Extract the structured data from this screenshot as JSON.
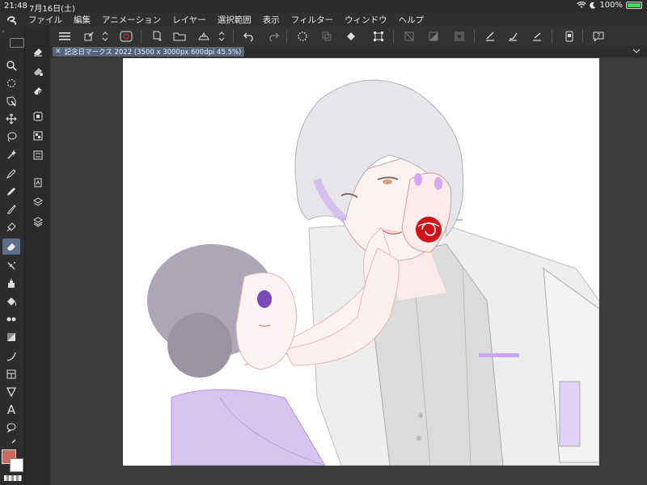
{
  "status": {
    "time": "21:48",
    "date": "7月16日(土)",
    "battery": "100%"
  },
  "menu": [
    "ファイル",
    "編集",
    "アニメーション",
    "レイヤー",
    "選択範囲",
    "表示",
    "フィルター",
    "ウィンドウ",
    "ヘルプ"
  ],
  "document": {
    "tab_title": "記念日マークス 2022 (3500 x 3000px 600dpi 45.5%)"
  },
  "colors": {
    "main": "#c9685b",
    "sub": "#ffffff",
    "tab_active": "#56647a",
    "tool_selected": "#5e6f8c"
  },
  "tools": {
    "left": [
      "search-icon",
      "zoom-rotate-icon",
      "operation-icon",
      "move-icon",
      "lasso-icon",
      "magic-wand-icon",
      "pen-icon",
      "pencil-icon",
      "brush-icon",
      "decorate-icon",
      "eraser-icon",
      "blend-icon",
      "airbrush-icon",
      "fill-icon",
      "gradient-icon",
      "figure-icon",
      "frame-icon",
      "ruler-icon",
      "text-icon",
      "balloon-icon"
    ],
    "selected": "eraser-icon"
  },
  "commands": [
    "menu-icon",
    "canvas-settings-icon",
    "stepper-icon",
    "clip-studio-icon",
    "new-icon",
    "open-icon",
    "save-icon",
    "stepper-icon",
    "undo-icon",
    "redo-icon",
    "loading-icon",
    "copy-icon",
    "fill-icon",
    "transform-icon",
    "clear-outside-icon",
    "selection-icon",
    "show-selection-icon",
    "apply-correction-icon",
    "brush-icon",
    "ruler-icon",
    "smartphone-icon",
    "help-icon"
  ]
}
